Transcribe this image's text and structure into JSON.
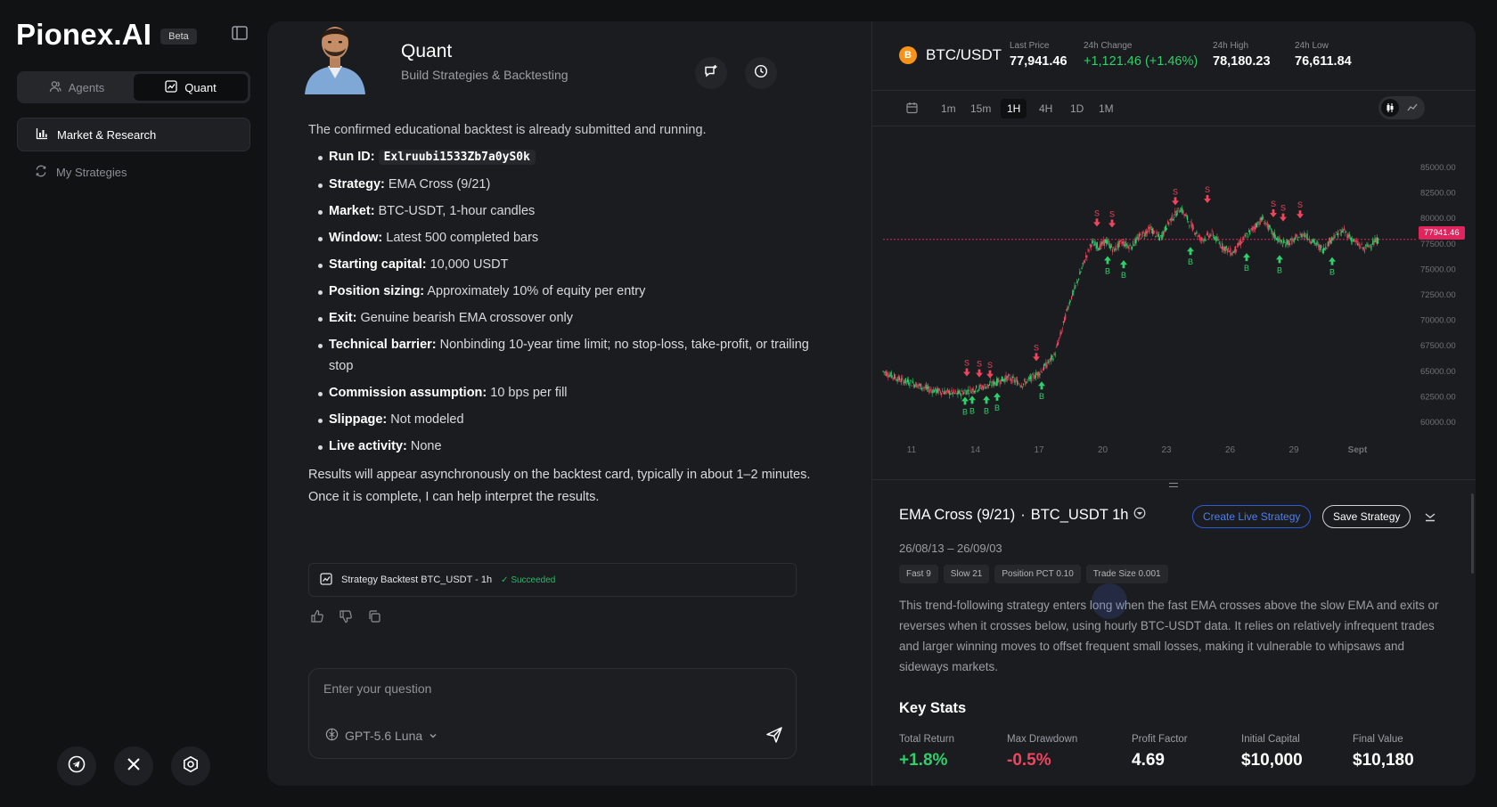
{
  "brand": {
    "name": "Pionex.AI",
    "badge": "Beta"
  },
  "sidebar": {
    "tabs": [
      {
        "label": "Agents",
        "icon": "agents-icon",
        "active": false
      },
      {
        "label": "Quant",
        "icon": "quant-icon",
        "active": true
      }
    ],
    "items": [
      {
        "label": "Market & Research",
        "icon": "bar-chart-icon",
        "active": true
      },
      {
        "label": "My Strategies",
        "icon": "strategies-icon",
        "active": false
      }
    ],
    "social": [
      "telegram-icon",
      "x-icon",
      "settings-icon"
    ]
  },
  "agent": {
    "title": "Quant",
    "subtitle": "Build Strategies & Backtesting"
  },
  "message": {
    "intro": "The confirmed educational backtest is already submitted and running.",
    "bullets": [
      {
        "key": "Run ID:",
        "value": "Exlruubi1533Zb7a0yS0k"
      },
      {
        "key": "Strategy:",
        "value": " EMA Cross (9/21)"
      },
      {
        "key": "Market:",
        "value": " BTC-USDT, 1-hour candles"
      },
      {
        "key": "Window:",
        "value": " Latest 500 completed bars"
      },
      {
        "key": "Starting capital:",
        "value": " 10,000 USDT"
      },
      {
        "key": "Position sizing:",
        "value": " Approximately 10% of equity per entry"
      },
      {
        "key": "Exit:",
        "value": " Genuine bearish EMA crossover only"
      },
      {
        "key": "Technical barrier:",
        "value": " Nonbinding 10-year time limit; no stop-loss, take-profit, or trailing stop"
      },
      {
        "key": "Commission assumption:",
        "value": " 10 bps per fill"
      },
      {
        "key": "Slippage:",
        "value": " Not modeled"
      },
      {
        "key": "Live activity:",
        "value": " None"
      }
    ],
    "outro": "Results will appear asynchronously on the backtest card, typically in about 1–2 minutes. Once it is complete, I can help interpret the results."
  },
  "backtest_card": {
    "label": "Strategy Backtest BTC_USDT - 1h",
    "status": "Succeeded"
  },
  "input": {
    "placeholder": "Enter your question",
    "model": "GPT-5.6 Luna"
  },
  "ticker": {
    "pair": "BTC/USDT",
    "coin_glyph": "B",
    "stats": [
      {
        "label": "Last Price",
        "value": "77,941.46"
      },
      {
        "label": "24h Change",
        "value": "+1,121.46 (+1.46%)"
      },
      {
        "label": "24h High",
        "value": "78,180.23"
      },
      {
        "label": "24h Low",
        "value": "76,611.84"
      }
    ]
  },
  "timeframes": [
    "1m",
    "15m",
    "1H",
    "4H",
    "1D",
    "1M"
  ],
  "timeframe_active": "1H",
  "colors": {
    "up": "#2fcf6b",
    "down": "#f0445f",
    "accent": "#2f5ad6",
    "price_line": "#e0245e",
    "btc": "#f7931a"
  },
  "chart_data": {
    "type": "candlestick",
    "y_ticks": [
      "85000.00",
      "82500.00",
      "80000.00",
      "77500.00",
      "75000.00",
      "72500.00",
      "70000.00",
      "67500.00",
      "65000.00",
      "62500.00",
      "60000.00"
    ],
    "ylim": [
      60000,
      85000
    ],
    "x_ticks": [
      "11",
      "14",
      "17",
      "20",
      "23",
      "26",
      "29",
      "Sept"
    ],
    "last_price_label": "77941.46",
    "last_price": 77941.46,
    "price_path": [
      [
        0,
        65000
      ],
      [
        18,
        64200
      ],
      [
        34,
        63800
      ],
      [
        52,
        63200
      ],
      [
        66,
        63000
      ],
      [
        84,
        62800
      ],
      [
        100,
        63200
      ],
      [
        118,
        63600
      ],
      [
        140,
        64400
      ],
      [
        156,
        63700
      ],
      [
        176,
        64900
      ],
      [
        192,
        66500
      ],
      [
        200,
        68800
      ],
      [
        208,
        71500
      ],
      [
        217,
        73500
      ],
      [
        226,
        75800
      ],
      [
        234,
        77600
      ],
      [
        243,
        77200
      ],
      [
        250,
        77800
      ],
      [
        259,
        76900
      ],
      [
        268,
        77700
      ],
      [
        278,
        77200
      ],
      [
        289,
        78300
      ],
      [
        300,
        79000
      ],
      [
        311,
        78000
      ],
      [
        322,
        79800
      ],
      [
        334,
        81000
      ],
      [
        346,
        79300
      ],
      [
        357,
        77900
      ],
      [
        369,
        78500
      ],
      [
        380,
        77300
      ],
      [
        392,
        76600
      ],
      [
        403,
        77800
      ],
      [
        415,
        79000
      ],
      [
        426,
        80000
      ],
      [
        438,
        78400
      ],
      [
        449,
        77500
      ],
      [
        460,
        77800
      ],
      [
        472,
        78500
      ],
      [
        483,
        77700
      ],
      [
        494,
        76900
      ],
      [
        505,
        78200
      ],
      [
        517,
        78800
      ],
      [
        528,
        77800
      ],
      [
        540,
        77000
      ],
      [
        548,
        77500
      ],
      [
        556,
        77900
      ]
    ],
    "buy_markers": [
      {
        "t": 92,
        "price": 62500
      },
      {
        "t": 100,
        "price": 62600
      },
      {
        "t": 116,
        "price": 62600
      },
      {
        "t": 128,
        "price": 62900
      },
      {
        "t": 178,
        "price": 64000
      },
      {
        "t": 252,
        "price": 76300
      },
      {
        "t": 270,
        "price": 75900
      },
      {
        "t": 345,
        "price": 77200
      },
      {
        "t": 408,
        "price": 76600
      },
      {
        "t": 445,
        "price": 76400
      },
      {
        "t": 504,
        "price": 76200
      }
    ],
    "sell_markers": [
      {
        "t": 94,
        "price": 64500
      },
      {
        "t": 108,
        "price": 64400
      },
      {
        "t": 120,
        "price": 64300
      },
      {
        "t": 172,
        "price": 66000
      },
      {
        "t": 240,
        "price": 79200
      },
      {
        "t": 257,
        "price": 79100
      },
      {
        "t": 328,
        "price": 81300
      },
      {
        "t": 364,
        "price": 81500
      },
      {
        "t": 438,
        "price": 80100
      },
      {
        "t": 449,
        "price": 79700
      },
      {
        "t": 468,
        "price": 80000
      }
    ],
    "buy_label": "B",
    "sell_label": "S"
  },
  "strategy": {
    "title": "EMA Cross (9/21)",
    "sep": "·",
    "symbol": "BTC_USDT 1h",
    "create_live": "Create Live Strategy",
    "save": "Save Strategy",
    "date_range": "26/08/13 – 26/09/03",
    "tags": [
      "Fast 9",
      "Slow 21",
      "Position PCT 0.10",
      "Trade Size 0.001"
    ],
    "description": "This trend-following strategy enters long when the fast EMA crosses above the slow EMA and exits or reverses when it crosses below, using hourly BTC-USDT data. It relies on relatively infrequent trades and larger winning moves to offset frequent small losses, making it vulnerable to whipsaws and sideways markets.",
    "key_stats_title": "Key Stats",
    "key_stats": [
      {
        "label": "Total Return",
        "value": "+1.8%",
        "tone": "green"
      },
      {
        "label": "Max Drawdown",
        "value": "-0.5%",
        "tone": "red"
      },
      {
        "label": "Profit Factor",
        "value": "4.69",
        "tone": ""
      },
      {
        "label": "Initial Capital",
        "value": "$10,000",
        "tone": ""
      },
      {
        "label": "Final Value",
        "value": "$10,180",
        "tone": ""
      }
    ]
  }
}
